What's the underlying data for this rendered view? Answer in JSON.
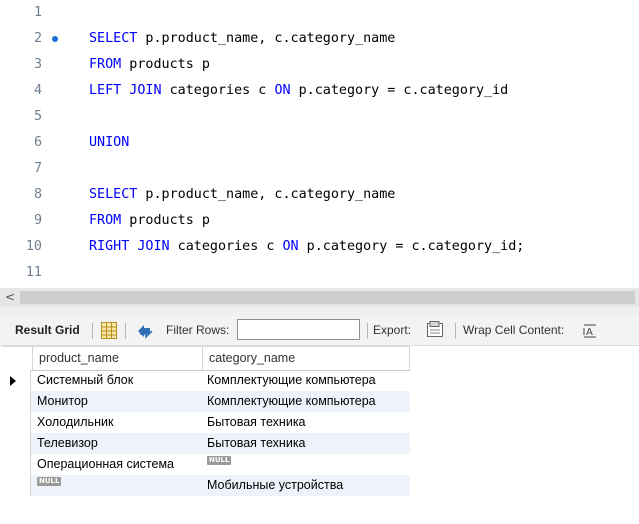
{
  "editor": {
    "lines": [
      {
        "num": "1",
        "tokens": []
      },
      {
        "num": "2",
        "marker": true,
        "tokens": [
          {
            "t": "SELECT",
            "k": true
          },
          {
            "t": " p.product_name, c.category_name",
            "k": false
          }
        ]
      },
      {
        "num": "3",
        "tokens": [
          {
            "t": "FROM",
            "k": true
          },
          {
            "t": " products p",
            "k": false
          }
        ]
      },
      {
        "num": "4",
        "tokens": [
          {
            "t": "LEFT JOIN",
            "k": true
          },
          {
            "t": " categories c ",
            "k": false
          },
          {
            "t": "ON",
            "k": true
          },
          {
            "t": " p.category = c.category_id",
            "k": false
          }
        ]
      },
      {
        "num": "5",
        "tokens": []
      },
      {
        "num": "6",
        "tokens": [
          {
            "t": "UNION",
            "k": true
          }
        ]
      },
      {
        "num": "7",
        "tokens": []
      },
      {
        "num": "8",
        "tokens": [
          {
            "t": "SELECT",
            "k": true
          },
          {
            "t": " p.product_name, c.category_name",
            "k": false
          }
        ]
      },
      {
        "num": "9",
        "tokens": [
          {
            "t": "FROM",
            "k": true
          },
          {
            "t": " products p",
            "k": false
          }
        ]
      },
      {
        "num": "10",
        "tokens": [
          {
            "t": "RIGHT JOIN",
            "k": true
          },
          {
            "t": " categories c ",
            "k": false
          },
          {
            "t": "ON",
            "k": true
          },
          {
            "t": " p.category = c.category_id;",
            "k": false
          }
        ]
      },
      {
        "num": "11",
        "tokens": []
      }
    ],
    "scroll_left_glyph": "<"
  },
  "toolbar": {
    "result_grid_label": "Result Grid",
    "filter_rows_label": "Filter Rows:",
    "filter_value": "",
    "export_label": "Export:",
    "wrap_label": "Wrap Cell Content:",
    "icons": [
      "grid-view-icon",
      "refresh-icon",
      "export-icon",
      "wrap-cell-icon"
    ]
  },
  "grid": {
    "columns": [
      "product_name",
      "category_name"
    ],
    "null_label": "NULL",
    "rows": [
      {
        "product_name": "Системный блок",
        "category_name": "Комплектующие компьютера",
        "current": true
      },
      {
        "product_name": "Монитор",
        "category_name": "Комплектующие компьютера"
      },
      {
        "product_name": "Холодильник",
        "category_name": "Бытовая техника"
      },
      {
        "product_name": "Телевизор",
        "category_name": "Бытовая техника"
      },
      {
        "product_name": "Операционная система",
        "category_name": null
      },
      {
        "product_name": null,
        "category_name": "Мобильные устройства"
      }
    ]
  },
  "colors": {
    "keyword": "#0000ff",
    "line_number": "#6f7f8f",
    "marker": "#1e6fd9",
    "alt_row": "#eef3fb"
  }
}
